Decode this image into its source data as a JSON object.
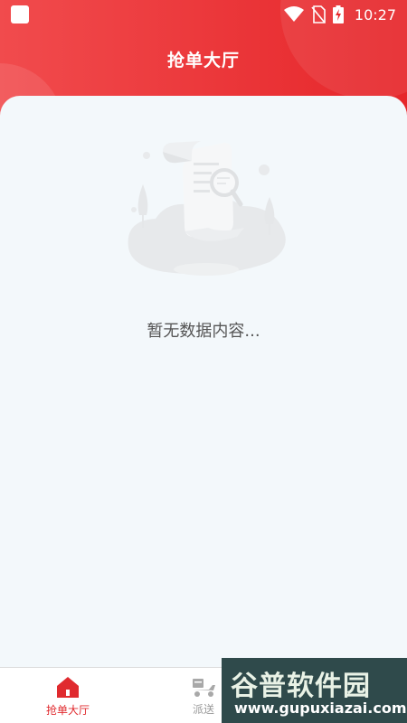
{
  "status_bar": {
    "time": "10:27",
    "icons": [
      "notification-icon",
      "wifi-icon",
      "no-sim-icon",
      "battery-charging-icon"
    ]
  },
  "header": {
    "title": "抢单大厅",
    "background_color": "#e6262a"
  },
  "content": {
    "empty_message": "暂无数据内容...",
    "illustration": "empty-document-search-illustration"
  },
  "tabbar": {
    "tabs": [
      {
        "label": "抢单大厅",
        "icon": "home-icon",
        "active": true,
        "color": "#e02a2e"
      },
      {
        "label": "派送",
        "icon": "delivery-scooter-icon",
        "active": false,
        "color": "#9a9a9a"
      }
    ]
  },
  "watermark": {
    "brand": "谷普软件园",
    "url": "www.gupuxiazai.com"
  }
}
